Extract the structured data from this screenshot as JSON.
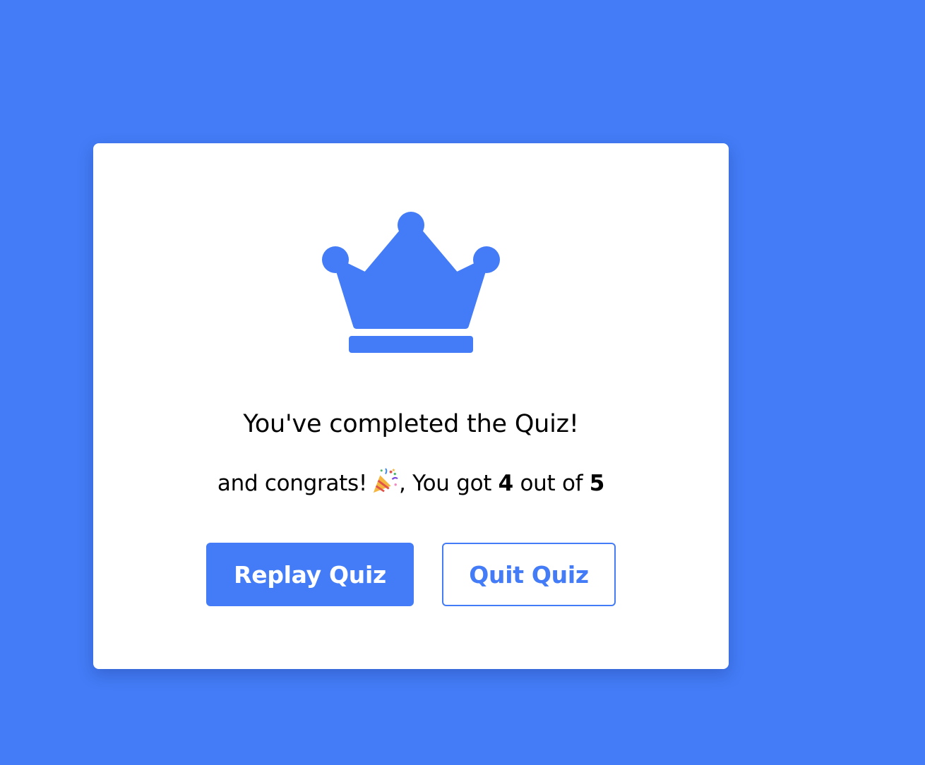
{
  "colors": {
    "background": "#437cf6",
    "accent": "#437cf6",
    "card": "#ffffff",
    "text": "#000000"
  },
  "result": {
    "icon": "crown-icon",
    "complete_text": "You've completed the Quiz!",
    "score_prefix": "and congrats!",
    "score_emoji": "party-popper-icon",
    "score_mid": ", You got",
    "score_value": "4",
    "score_of": "out of",
    "score_total": "5"
  },
  "buttons": {
    "replay_label": "Replay Quiz",
    "quit_label": "Quit Quiz"
  }
}
